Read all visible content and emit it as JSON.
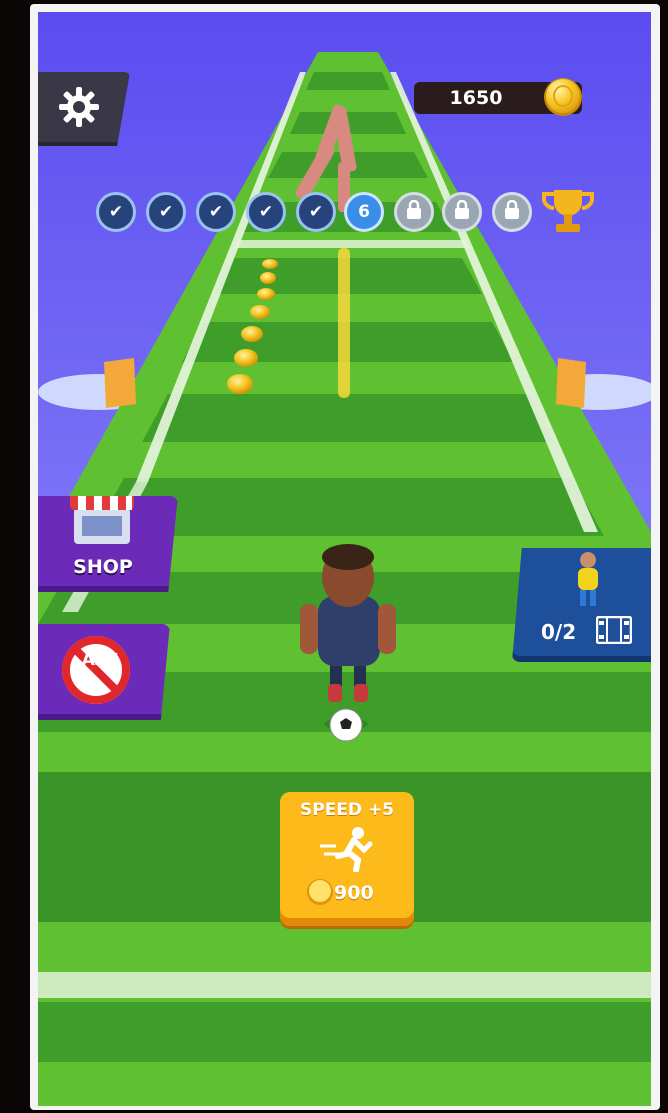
{
  "hud": {
    "coins": "1650",
    "coin_icon": "coin-icon",
    "settings_icon": "gear-icon"
  },
  "level_progress": {
    "completed_levels": 5,
    "current_level": "6",
    "locked_levels": 3,
    "goal_icon": "trophy-icon"
  },
  "left_menu": {
    "shop_label": "SHOP",
    "no_ads_label": "ADS"
  },
  "rescue": {
    "progress": "0/2",
    "video_icon": "film-icon"
  },
  "upgrade": {
    "speed_label": "SPEED +5",
    "cost": "900",
    "icon": "runner-icon"
  },
  "colors": {
    "sky": "#6f58f0",
    "grass_light": "#6ccf32",
    "grass_dark": "#3b9a28",
    "gold": "#fdbb1b",
    "purple_button": "#6b2bb8",
    "blue_card": "#1d4f9a"
  }
}
